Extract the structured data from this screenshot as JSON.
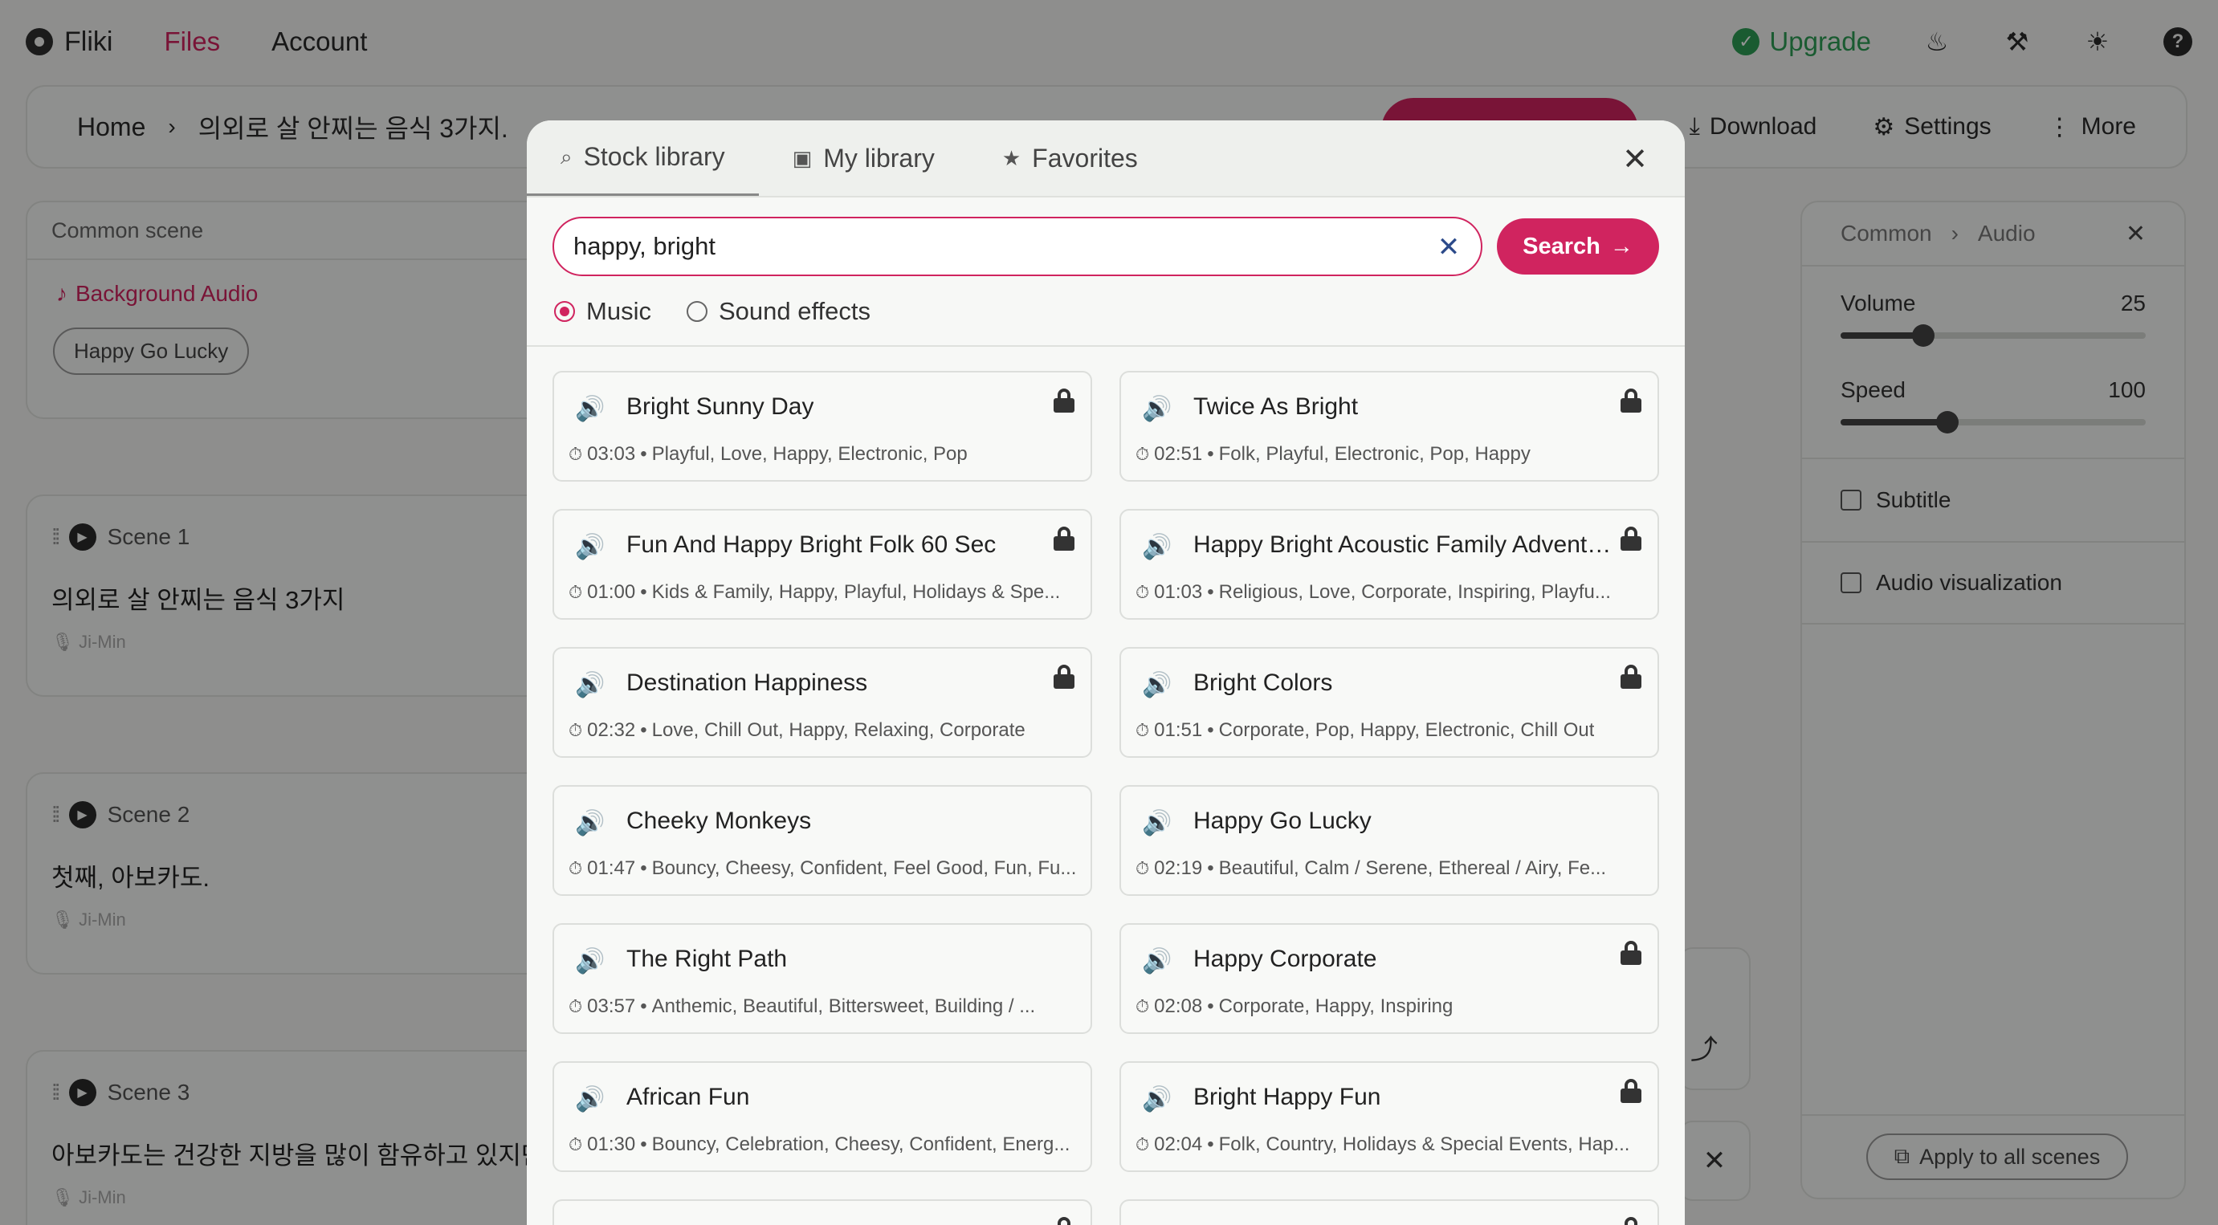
{
  "app": {
    "brand": "Fliki",
    "nav": [
      "Files",
      "Account"
    ],
    "upgrade_label": "Upgrade",
    "icons": [
      "fire-icon",
      "tools-icon",
      "sun-icon",
      "help-icon"
    ]
  },
  "breadcrumb": {
    "home": "Home",
    "title": "의외로 살 안찌는 음식 3가지.",
    "actions": {
      "download": "Download",
      "settings": "Settings",
      "more": "More"
    }
  },
  "common_scene": {
    "header": "Common scene",
    "background_audio": "Background Audio",
    "chip": "Happy Go Lucky"
  },
  "scenes": [
    {
      "label": "Scene 1",
      "text": "의외로 살 안찌는 음식 3가지",
      "voice": "Ji-Min"
    },
    {
      "label": "Scene 2",
      "text": "첫째, 아보카도.",
      "voice": "Ji-Min"
    },
    {
      "label": "Scene 3",
      "text": "아보카도는 건강한 지방을 많이 함유하고 있지만",
      "voice": "Ji-Min"
    }
  ],
  "right_panel": {
    "crumb": [
      "Common",
      "Audio"
    ],
    "volume": {
      "label": "Volume",
      "value": "25",
      "fraction": 0.27
    },
    "speed": {
      "label": "Speed",
      "value": "100",
      "fraction": 0.35
    },
    "subtitle_label": "Subtitle",
    "audio_vis_label": "Audio visualization",
    "apply_all": "Apply to all scenes"
  },
  "modal": {
    "tabs": [
      {
        "label": "Stock library",
        "icon": "search-icon",
        "active": true
      },
      {
        "label": "My library",
        "icon": "image-icon",
        "active": false
      },
      {
        "label": "Favorites",
        "icon": "star-icon",
        "active": false
      }
    ],
    "search": {
      "value": "happy, bright",
      "button": "Search"
    },
    "types": [
      {
        "label": "Music",
        "selected": true
      },
      {
        "label": "Sound effects",
        "selected": false
      }
    ],
    "tracks": [
      {
        "name": "Bright Sunny Day",
        "duration": "03:03",
        "tags": "Playful, Love, Happy, Electronic, Pop",
        "locked": true
      },
      {
        "name": "Twice As Bright",
        "duration": "02:51",
        "tags": "Folk, Playful, Electronic, Pop, Happy",
        "locked": true
      },
      {
        "name": "Fun And Happy Bright Folk 60 Sec",
        "duration": "01:00",
        "tags": "Kids & Family, Happy, Playful, Holidays & Spe...",
        "locked": true
      },
      {
        "name": "Happy Bright Acoustic Family Adventu...",
        "duration": "01:03",
        "tags": "Religious, Love, Corporate, Inspiring, Playfu...",
        "locked": true
      },
      {
        "name": "Destination Happiness",
        "duration": "02:32",
        "tags": "Love, Chill Out, Happy, Relaxing, Corporate",
        "locked": true
      },
      {
        "name": "Bright Colors",
        "duration": "01:51",
        "tags": "Corporate, Pop, Happy, Electronic, Chill Out",
        "locked": true
      },
      {
        "name": "Cheeky Monkeys",
        "duration": "01:47",
        "tags": "Bouncy, Cheesy, Confident, Feel Good, Fun, Fu...",
        "locked": false
      },
      {
        "name": "Happy Go Lucky",
        "duration": "02:19",
        "tags": "Beautiful, Calm / Serene, Ethereal / Airy, Fe...",
        "locked": false
      },
      {
        "name": "The Right Path",
        "duration": "03:57",
        "tags": "Anthemic, Beautiful, Bittersweet, Building / ...",
        "locked": false
      },
      {
        "name": "Happy Corporate",
        "duration": "02:08",
        "tags": "Corporate, Happy, Inspiring",
        "locked": true
      },
      {
        "name": "African Fun",
        "duration": "01:30",
        "tags": "Bouncy, Celebration, Cheesy, Confident, Energ...",
        "locked": false
      },
      {
        "name": "Bright Happy Fun",
        "duration": "02:04",
        "tags": "Folk, Country, Holidays & Special Events, Hap...",
        "locked": true
      }
    ]
  },
  "colors": {
    "accent": "#d0245f",
    "upgrade": "#2e9e55",
    "clear_icon": "#2c4a8a"
  }
}
